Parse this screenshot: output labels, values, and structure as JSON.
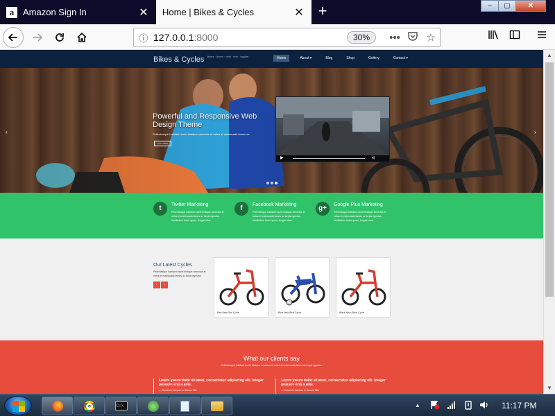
{
  "browser": {
    "tabs": [
      {
        "label": "Amazon Sign In",
        "active": false,
        "favicon": "amazon-icon"
      },
      {
        "label": "Home | Bikes & Cycles",
        "active": true,
        "favicon": "none"
      }
    ],
    "new_tab": "+",
    "url_host": "127.0.0.1",
    "url_port": ":8000",
    "zoom": "30%",
    "window_controls": {
      "minimize": "–",
      "restore": "▢",
      "close": "✕"
    }
  },
  "site": {
    "brand": "Bikes & Cycles",
    "tagline": "bikes · lorem · mini · text · tagline",
    "menu": [
      {
        "label": "Home",
        "active": true
      },
      {
        "label": "About ▾",
        "active": false
      },
      {
        "label": "Blog",
        "active": false
      },
      {
        "label": "Shop",
        "active": false
      },
      {
        "label": "Gallery",
        "active": false
      },
      {
        "label": "Contact ▾",
        "active": false
      }
    ],
    "hero": {
      "title": "Powerful and Responsive Web Design Theme",
      "subtitle": "Pellentesque habitant morbi tristique senectus et netus et malesuada fames ac",
      "button": "Learn More",
      "prev": "‹",
      "next": "›",
      "slides": 3,
      "active_slide": 3
    },
    "features": [
      {
        "icon": "twitter-icon",
        "glyph": "t",
        "title": "Twitter Marketing",
        "text": "Pellentesque habitant morbi tristique senectus et netus et malesuada fames ac turpis egestas. Vestibulum tortor quam, feugiat vitae."
      },
      {
        "icon": "facebook-icon",
        "glyph": "f",
        "title": "Facebook Marketing",
        "text": "Pellentesque habitant morbi tristique senectus et netus et malesuada fames ac turpis egestas. Vestibulum tortor quam, feugiat vitae."
      },
      {
        "icon": "google-plus-icon",
        "glyph": "g+",
        "title": "Google Plus Marketing",
        "text": "Pellentesque habitant morbi tristique senectus et netus et malesuada fames ac turpis egestas. Vestibulum tortor quam, feugiat vitae."
      }
    ],
    "latest": {
      "title": "Our Latest Cycles",
      "text": "Pellentesque habitant morbi tristique senectus et netus et malesuada fames ac turpis egestas.",
      "prev": "‹",
      "next": "›",
      "products": [
        {
          "caption": "Red   New Red Cycle.",
          "color": "#d93a2b"
        },
        {
          "caption": "Blue   New Blue Cycle.",
          "color": "#2a4fb0"
        },
        {
          "caption": "Black   New Black Cycle.",
          "color": "#d93a2b"
        }
      ]
    },
    "clients": {
      "title": "What our clients say",
      "subtitle": "Pellentesque habitant morbi tristique senectus et netus et malesuada fames ac turpis egestas.",
      "quotes": [
        {
          "text": "Lorem ipsum dolor sit amet, consectetur adipiscing elit. Integer posuere erat a ante.",
          "author": "— Someone famous in Source Title"
        },
        {
          "text": "Lorem ipsum dolor sit amet, consectetur adipiscing elit. Integer posuere erat a ante.",
          "author": "— Someone famous in Source Title"
        }
      ]
    }
  },
  "taskbar": {
    "items": [
      {
        "icon": "firefox-icon",
        "active": true
      },
      {
        "icon": "chrome-icon",
        "active": false
      },
      {
        "icon": "terminal-icon",
        "active": false
      },
      {
        "icon": "app-icon",
        "active": false
      },
      {
        "icon": "notepad-icon",
        "active": false
      },
      {
        "icon": "folder-icon",
        "active": false
      }
    ],
    "clock": "11:17 PM",
    "tray_arrow": "▲",
    "tray_icons": [
      "flag-icon",
      "network-icon",
      "power-icon",
      "volume-icon"
    ]
  },
  "colors": {
    "header": "#0a2240",
    "features_bg": "#31c36a",
    "clients_bg": "#e74c3c",
    "accent_text": "#2d4868"
  }
}
